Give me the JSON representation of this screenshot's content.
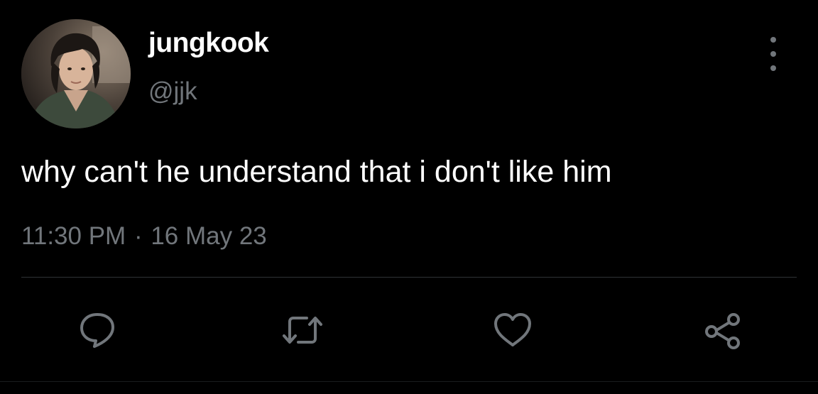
{
  "author": {
    "display_name": "jungkook",
    "handle": "@jjk",
    "avatar_icon": "profile-photo"
  },
  "tweet": {
    "text": "why can't he understand that i don't like him",
    "time": "11:30 PM",
    "separator": "·",
    "date": "16 May 23"
  },
  "actions": {
    "reply_icon": "comment-bubble-icon",
    "retweet_icon": "retweet-arrows-icon",
    "like_icon": "heart-icon",
    "share_icon": "share-nodes-icon"
  },
  "more_icon": "vertical-ellipsis-icon",
  "colors": {
    "background": "#000000",
    "primary_text": "#ffffff",
    "secondary_text": "#71767b",
    "divider": "#2f3336"
  }
}
